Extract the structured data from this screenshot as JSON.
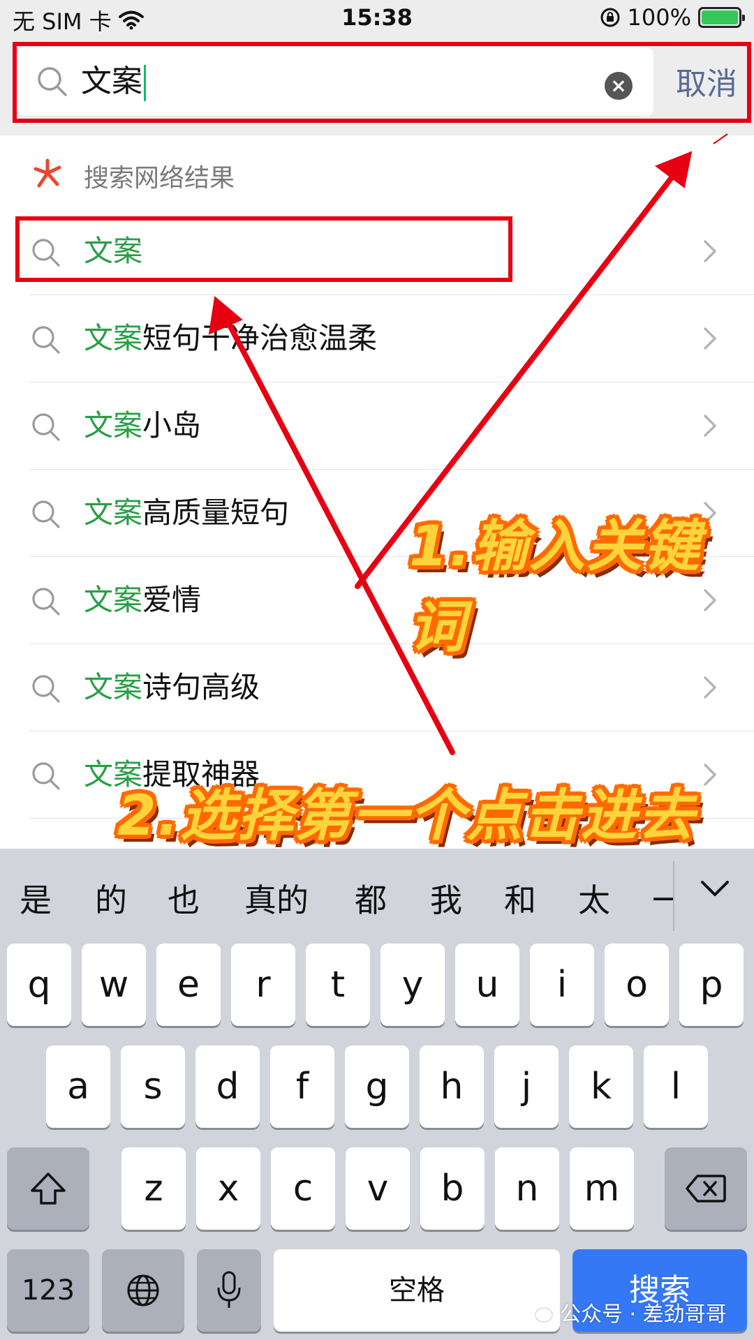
{
  "status_bar": {
    "carrier": "无 SIM 卡",
    "time": "15:38",
    "battery_percent": "100%"
  },
  "search": {
    "query": "文案",
    "cancel_label": "取消"
  },
  "results": {
    "section_label": "搜索网络结果",
    "items": [
      {
        "keyword": "文案",
        "suffix": ""
      },
      {
        "keyword": "文案",
        "suffix": "短句干净治愈温柔"
      },
      {
        "keyword": "文案",
        "suffix": "小岛"
      },
      {
        "keyword": "文案",
        "suffix": "高质量短句"
      },
      {
        "keyword": "文案",
        "suffix": "爱情"
      },
      {
        "keyword": "文案",
        "suffix": "诗句高级"
      },
      {
        "keyword": "文案",
        "suffix": "提取神器"
      }
    ]
  },
  "annotations": {
    "step1": "1.输入关键词",
    "step2": "2.选择第一个点击进去"
  },
  "keyboard": {
    "candidates": [
      "是",
      "的",
      "也",
      "真的",
      "都",
      "我",
      "和",
      "太",
      "一"
    ],
    "row1": [
      "q",
      "w",
      "e",
      "r",
      "t",
      "y",
      "u",
      "i",
      "o",
      "p"
    ],
    "row2": [
      "a",
      "s",
      "d",
      "f",
      "g",
      "h",
      "j",
      "k",
      "l"
    ],
    "row3": [
      "z",
      "x",
      "c",
      "v",
      "b",
      "n",
      "m"
    ],
    "numbers_label": "123",
    "space_label": "空格",
    "search_label": "搜索"
  },
  "watermark": {
    "text": "公众号 · 差劲哥哥"
  },
  "colors": {
    "accent_green": "#2a9e47",
    "annotation_red": "#e60012",
    "search_key_blue": "#3478f6",
    "cancel_link": "#576b95"
  }
}
